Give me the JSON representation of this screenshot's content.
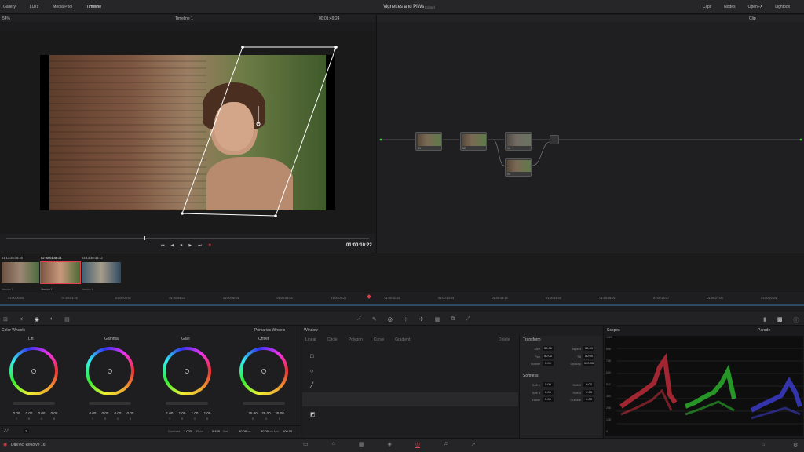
{
  "topbar": {
    "tabs": [
      "Gallery",
      "LUTs",
      "Media Pool",
      "Timeline"
    ],
    "project_title": "Vignettes and PiWs",
    "project_status": "Edited",
    "right_items": [
      "Clips",
      "Nodes",
      "OpenFX",
      "Lightbox"
    ]
  },
  "viewer": {
    "zoom": "54%",
    "timeline_name": "Timeline 1",
    "timecode": "00:01:49:24",
    "playhead_timecode": "01:00:10:22"
  },
  "node_panel": {
    "mode": "Clip",
    "nodes": [
      {
        "label": "01"
      },
      {
        "label": "02"
      },
      {
        "label": "03"
      },
      {
        "label": "04"
      }
    ]
  },
  "clips": [
    {
      "num": "01",
      "timecode": "13:25:35:16",
      "version": "Version 1"
    },
    {
      "num": "02",
      "timecode": "00:01:46:21",
      "version": "Version 1"
    },
    {
      "num": "03",
      "timecode": "13:35:34:12",
      "version": "Version 1"
    }
  ],
  "timeline_ticks": [
    "01:00:00:00",
    "01:00:01:16",
    "01:00:03:07",
    "01:00:04:23",
    "01:00:06:14",
    "01:00:08:05",
    "01:00:09:21",
    "01:00:11:12",
    "01:00:13:03",
    "01:00:14:19",
    "01:00:16:10",
    "01:00:18:01",
    "01:00:19:17",
    "01:00:21:08",
    "01:00:22:24"
  ],
  "color_wheels": {
    "title": "Color Wheels",
    "mode": "Primaries Wheels",
    "wheels": [
      {
        "name": "Lift",
        "values": [
          "0.00",
          "0.00",
          "0.00",
          "0.00"
        ]
      },
      {
        "name": "Gamma",
        "values": [
          "0.00",
          "0.00",
          "0.00",
          "0.00"
        ]
      },
      {
        "name": "Gain",
        "values": [
          "1.00",
          "1.00",
          "1.00",
          "1.00"
        ]
      },
      {
        "name": "Offset",
        "values": [
          "25.00",
          "25.00",
          "25.00"
        ]
      }
    ],
    "channel_labels_4": [
      "Y",
      "R",
      "G",
      "B"
    ],
    "channel_labels_3": [
      "R",
      "G",
      "B"
    ],
    "bottom": [
      {
        "label": "Contrast",
        "value": "1.000"
      },
      {
        "label": "Pivot",
        "value": "0.435"
      },
      {
        "label": "Sat",
        "value": "50.00"
      },
      {
        "label": "Hue",
        "value": "50.00"
      },
      {
        "label": "Lum Mix",
        "value": "100.00"
      }
    ],
    "page_number": "2"
  },
  "window_panel": {
    "title": "Window",
    "tools": [
      "Linear",
      "Circle",
      "Polygon",
      "Curve",
      "Gradient"
    ],
    "delete_label": "Delete",
    "transform_title": "Transform",
    "transform_fields": [
      {
        "label": "Size",
        "value": "50.00"
      },
      {
        "label": "Aspect",
        "value": "50.00"
      },
      {
        "label": "Pan",
        "value": "50.00"
      },
      {
        "label": "Tilt",
        "value": "50.00"
      },
      {
        "label": "Rotate",
        "value": "0.00"
      },
      {
        "label": "Opacity",
        "value": "100.00"
      }
    ],
    "softness_title": "Softness",
    "softness_fields": [
      {
        "label": "Soft 1",
        "value": "0.00"
      },
      {
        "label": "Soft 2",
        "value": "0.00"
      },
      {
        "label": "Soft 3",
        "value": "0.00"
      },
      {
        "label": "Soft 4",
        "value": "0.00"
      },
      {
        "label": "Inside",
        "value": "0.00"
      },
      {
        "label": "Outside",
        "value": "0.00"
      }
    ]
  },
  "scopes": {
    "title": "Scopes",
    "mode": "Parade",
    "scale": [
      "1023",
      "896",
      "768",
      "640",
      "512",
      "384",
      "256",
      "128",
      "0"
    ]
  },
  "app": {
    "name": "DaVinci Resolve 16"
  },
  "colors": {
    "accent": "#e0404a",
    "panel": "#1e1e20",
    "dark": "#131314"
  }
}
